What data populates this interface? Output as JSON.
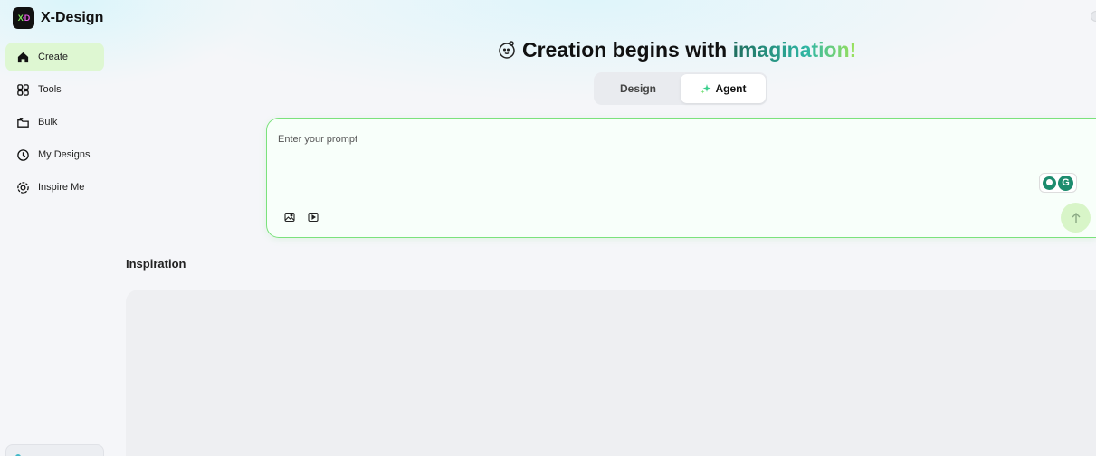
{
  "app": {
    "name": "X-Design",
    "logo_mark_left": "X",
    "logo_mark_right": "D"
  },
  "sidebar": {
    "items": [
      {
        "label": "Create",
        "icon": "home-icon",
        "active": true
      },
      {
        "label": "Tools",
        "icon": "grid-icon",
        "active": false
      },
      {
        "label": "Bulk",
        "icon": "folder-stack-icon",
        "active": false
      },
      {
        "label": "My Designs",
        "icon": "clock-icon",
        "active": false
      },
      {
        "label": "Inspire Me",
        "icon": "inspire-icon",
        "active": false
      }
    ]
  },
  "hero": {
    "title_plain": "Creation begins with ",
    "title_accent": "imagination!",
    "icon": "mascot-face-icon"
  },
  "mode_switch": {
    "tabs": [
      {
        "label": "Design",
        "active": false
      },
      {
        "label": "Agent",
        "active": true,
        "icon": "sparkle-icon"
      }
    ]
  },
  "prompt": {
    "placeholder": "Enter your prompt",
    "value": ""
  },
  "sections": {
    "inspiration_title": "Inspiration"
  },
  "colors": {
    "accent_green": "#7be27c",
    "active_nav_bg": "#def7d2",
    "send_button_bg": "#d8f5c8"
  }
}
